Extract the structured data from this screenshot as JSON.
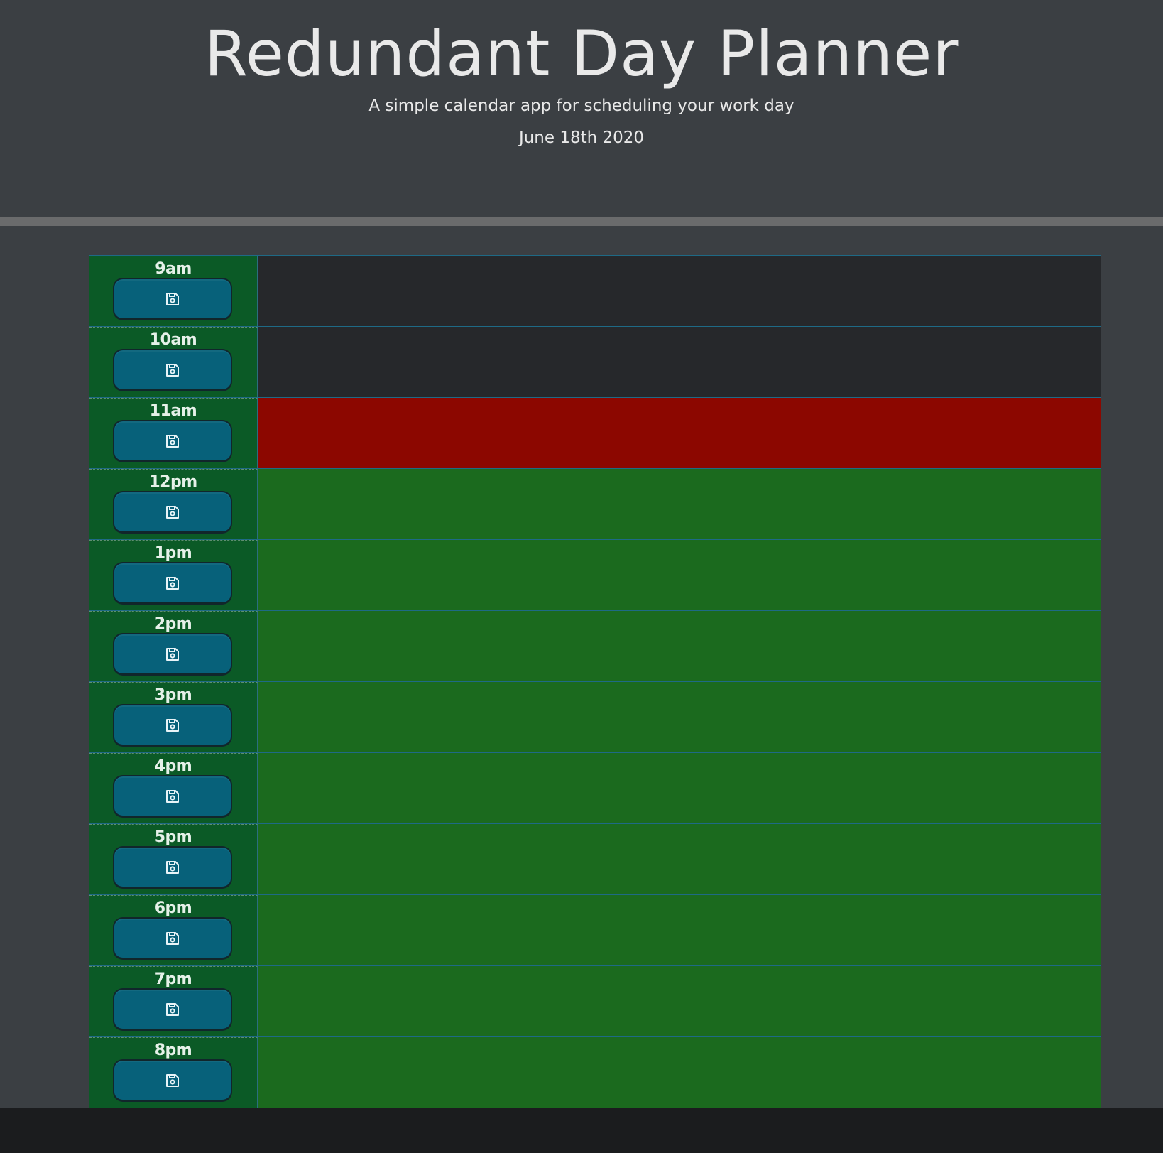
{
  "header": {
    "title": "Redundant Day Planner",
    "subtitle": "A simple calendar app for scheduling your work day",
    "date": "June 18th 2020"
  },
  "colors": {
    "past": "#26282b",
    "present": "#8c0700",
    "future": "#1b6a1e",
    "hour_column": "#0b5a26",
    "save_button": "#07617a"
  },
  "save_icon": "floppy-disk-icon",
  "time_blocks": [
    {
      "hour": "9am",
      "status": "past",
      "text": ""
    },
    {
      "hour": "10am",
      "status": "past",
      "text": ""
    },
    {
      "hour": "11am",
      "status": "present",
      "text": ""
    },
    {
      "hour": "12pm",
      "status": "future",
      "text": ""
    },
    {
      "hour": "1pm",
      "status": "future",
      "text": ""
    },
    {
      "hour": "2pm",
      "status": "future",
      "text": ""
    },
    {
      "hour": "3pm",
      "status": "future",
      "text": ""
    },
    {
      "hour": "4pm",
      "status": "future",
      "text": ""
    },
    {
      "hour": "5pm",
      "status": "future",
      "text": ""
    },
    {
      "hour": "6pm",
      "status": "future",
      "text": ""
    },
    {
      "hour": "7pm",
      "status": "future",
      "text": ""
    },
    {
      "hour": "8pm",
      "status": "future",
      "text": ""
    }
  ]
}
